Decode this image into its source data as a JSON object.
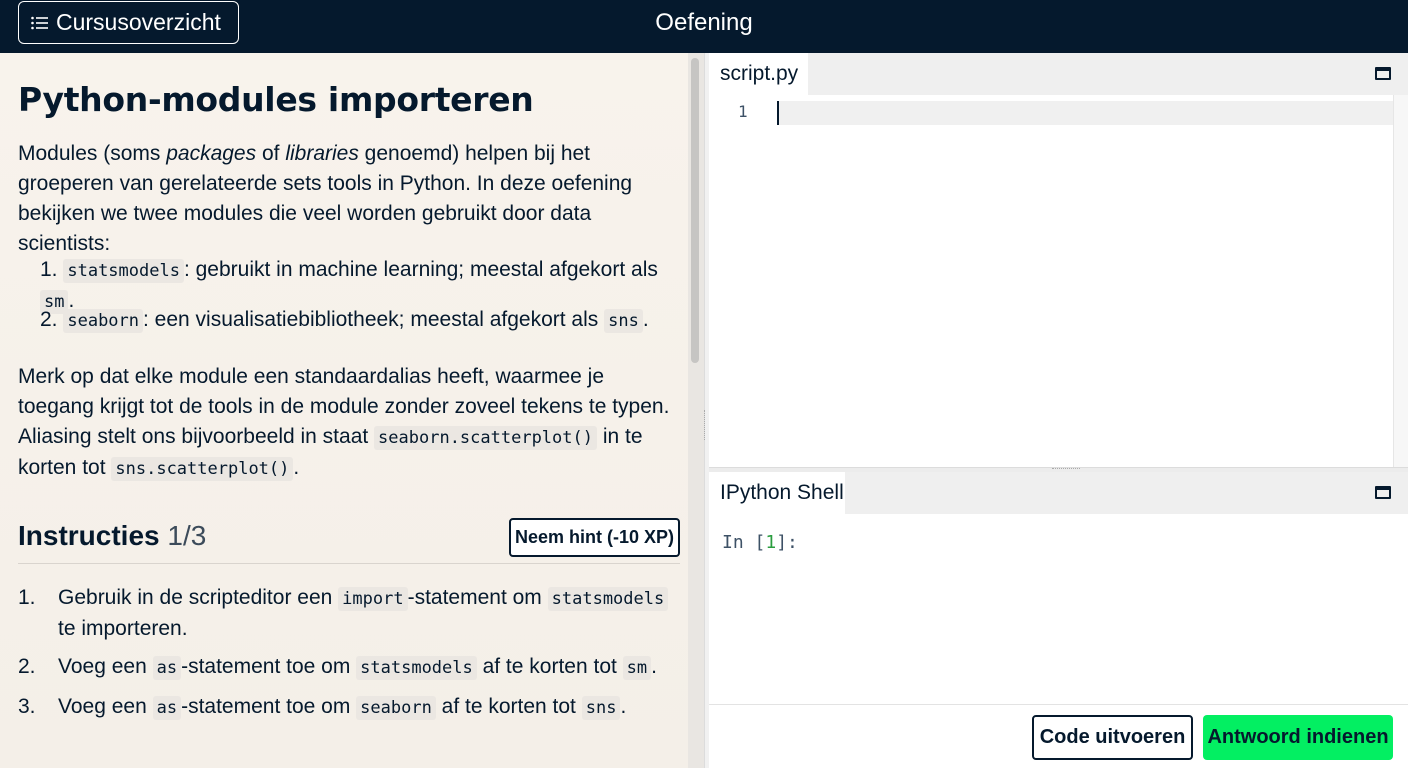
{
  "header": {
    "course_button_label": "Cursusoverzicht",
    "course_button_icon": "list-icon",
    "title": "Oefening"
  },
  "exercise": {
    "title": "Python-modules importeren",
    "intro": {
      "t1": "Modules (soms ",
      "em1": "packages",
      "t2": " of ",
      "em2": "libraries",
      "t3": " genoemd) helpen bij het groeperen van gerelateerde sets tools in Python. In deze oefening bekijken we twee modules die veel worden gebruikt door data scientists:"
    },
    "modules": [
      {
        "num": "1.",
        "code": "statsmodels",
        "text": ": gebruikt in machine learning; meestal afgekort als ",
        "alias": "sm",
        "end": "."
      },
      {
        "num": "2.",
        "code": "seaborn",
        "text": ": een visualisatiebibliotheek; meestal afgekort als ",
        "alias": "sns",
        "end": "."
      }
    ],
    "alias_note": {
      "t1": "Merk op dat elke module een standaardalias heeft, waarmee je toegang krijgt tot de tools in de module zonder zoveel tekens te typen. Aliasing stelt ons bijvoorbeeld in staat ",
      "code1": "seaborn.scatterplot()",
      "t2": " in te korten tot ",
      "code2": "sns.scatterplot()",
      "t3": "."
    }
  },
  "instructions": {
    "title": "Instructies",
    "count": "1/3",
    "hint_button": "Neem hint (-10 XP)",
    "steps": [
      {
        "num": "1.",
        "t1": "Gebruik in de scripteditor een ",
        "c1": "import",
        "t2": "-statement om ",
        "c2": "statsmodels",
        "t3": " te importeren."
      },
      {
        "num": "2.",
        "t1": "Voeg een ",
        "c1": "as",
        "t2": "-statement toe om ",
        "c2": "statsmodels",
        "t3": " af te korten tot ",
        "c3": "sm",
        "t4": "."
      },
      {
        "num": "3.",
        "t1": "Voeg een ",
        "c1": "as",
        "t2": "-statement toe om ",
        "c2": "seaborn",
        "t3": " af te korten tot ",
        "c3": "sns",
        "t4": "."
      }
    ]
  },
  "editor": {
    "tab_label": "script.py",
    "line_numbers": [
      "1"
    ],
    "code": ""
  },
  "shell": {
    "tab_label": "IPython Shell",
    "prompt_prefix": "In [",
    "prompt_number": "1",
    "prompt_suffix": "]:"
  },
  "actions": {
    "run_label": "Code uitvoeren",
    "submit_label": "Antwoord indienen"
  },
  "colors": {
    "navy": "#05192d",
    "green": "#03ef62",
    "background": "#f7f3ee"
  }
}
